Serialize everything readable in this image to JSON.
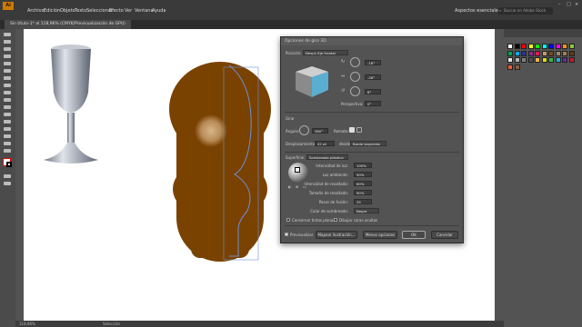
{
  "window": {
    "close_icon": "close-icon",
    "min_icon": "minimize-icon",
    "max_icon": "maximize-icon"
  },
  "menu": {
    "logo": "Ai",
    "items": [
      "Archivo",
      "Edición",
      "Objeto",
      "Texto",
      "Seleccionar",
      "Efecto",
      "Ver",
      "Ventana",
      "Ayuda"
    ],
    "workspace": "Aspectos esenciales",
    "search_placeholder": "Buscar en Adobe Stock"
  },
  "document": {
    "tab_title": "Sin título-1* al 118,96% (CMYK/Previsualización de GPU)"
  },
  "dialog": {
    "title": "Opciones de giro 3D",
    "position_label": "Posición:",
    "position_value": "Desp1-Eje frontal",
    "rot_x": "-18°",
    "rot_y": "-26°",
    "rot_z": "8°",
    "perspective_label": "Perspectiva:",
    "perspective_value": "0°",
    "extrude_section": "Girar",
    "angle_label": "Ángulo:",
    "angle_value": "360°",
    "cap_label": "Remate:",
    "offset_label": "Desplazamiento:",
    "offset_value": "42 pt",
    "from_label": "desde",
    "from_value": "Borde izquierdo",
    "surface_label": "Superficie:",
    "surface_value": "Sombreado plástico",
    "light_intensity_label": "Intensidad de luz:",
    "light_intensity_value": "100%",
    "ambient_label": "Luz ambiente:",
    "ambient_value": "50%",
    "highlight_intensity_label": "Intensidad de resaltado:",
    "highlight_intensity_value": "60%",
    "highlight_size_label": "Tamaño de resaltado:",
    "highlight_size_value": "90%",
    "blend_steps_label": "Pasos de fusión:",
    "blend_steps_value": "25",
    "shading_color_label": "Color de sombreado:",
    "shading_color_value": "Negro",
    "preserve_spot_label": "Conservar tintas planas",
    "draw_hidden_label": "Dibujar caras ocultas",
    "preview_label": "Previsualizar",
    "map_art_label": "Mapear ilustración...",
    "fewer_options_label": "Menos opciones",
    "ok_label": "OK",
    "cancel_label": "Cancelar"
  },
  "status": {
    "zoom": "118,96%",
    "tool": "Selección"
  },
  "colors": {
    "app_bg": "#535353",
    "menubar": "#3a3a3a",
    "artboard": "#ffffff",
    "brown_shape": "#7a4200",
    "cube_face": "#5aaed0",
    "goblet": "#9aa0ab"
  },
  "swatches": [
    "#ffffff",
    "#000000",
    "#ff0000",
    "#ffff00",
    "#00ff00",
    "#00ffff",
    "#0000ff",
    "#ff00ff",
    "#f7941d",
    "#8dc63f",
    "#00a651",
    "#00aeef",
    "#2e3192",
    "#92278f",
    "#ed145b",
    "#c69c6d",
    "#754c24",
    "#998675",
    "#a67c52",
    "#603913",
    "#e6e6e6",
    "#b3b3b3",
    "#808080",
    "#4d4d4d",
    "#fbb040",
    "#d7df23",
    "#39b54a",
    "#27aae1",
    "#662d91",
    "#be1e2d",
    "#f15a29",
    "#8b5e3c"
  ]
}
